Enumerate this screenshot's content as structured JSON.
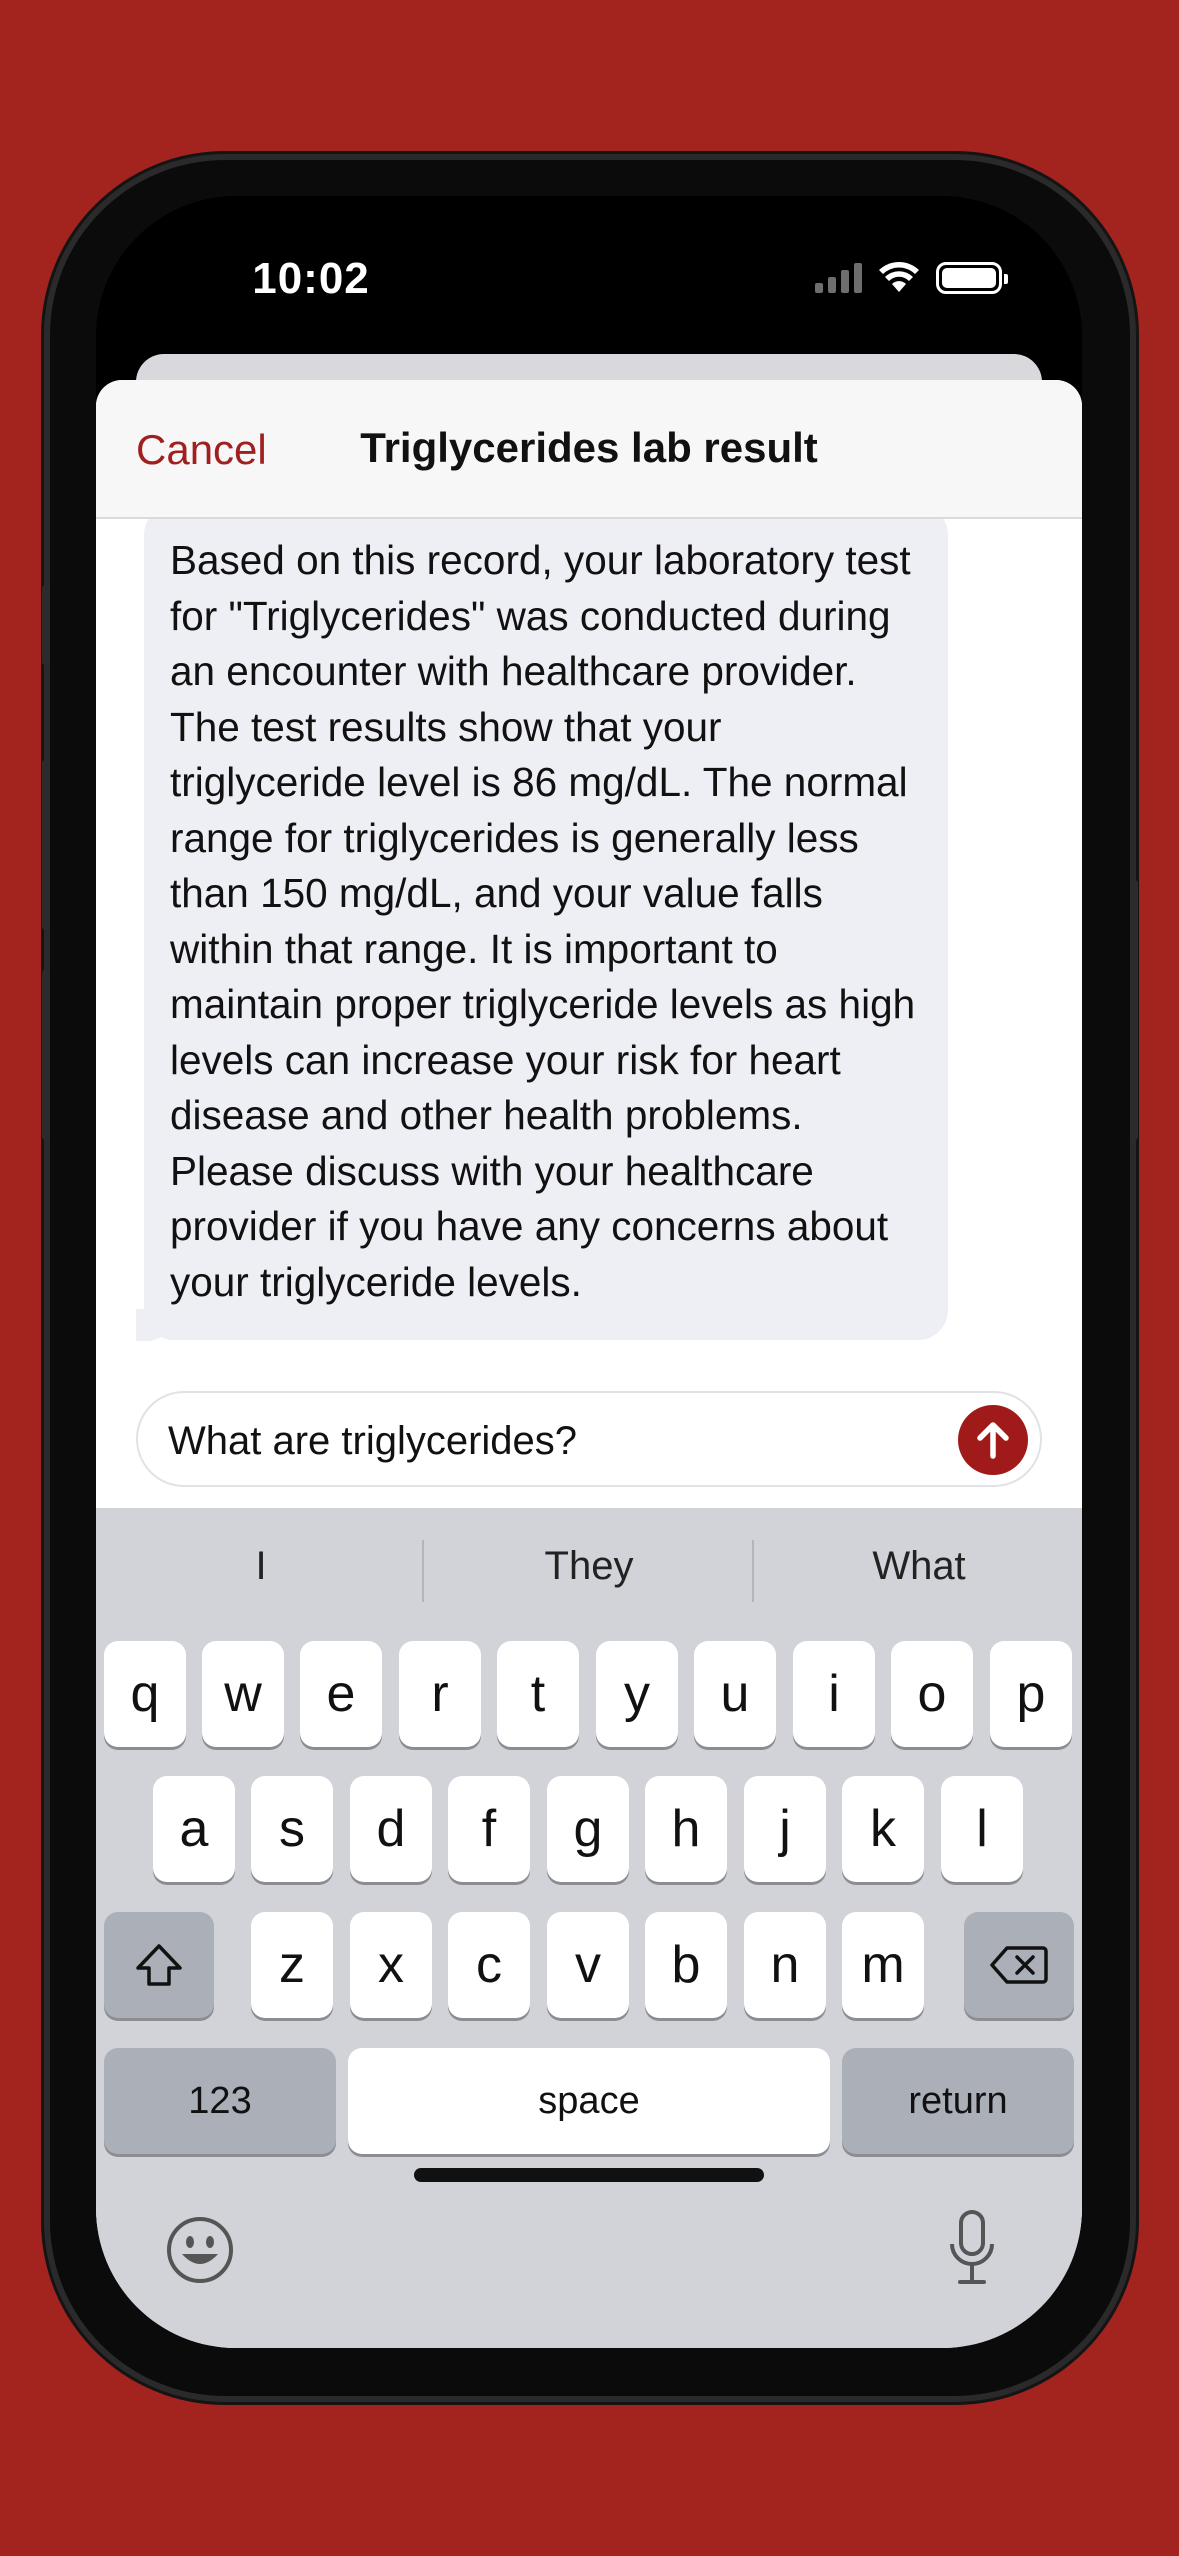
{
  "status_bar": {
    "time": "10:02"
  },
  "nav": {
    "cancel_label": "Cancel",
    "title": "Triglycerides lab result"
  },
  "chat": {
    "assistant_message": "Based on this record, your laboratory test for \"Triglycerides\" was conducted during an encounter with healthcare provider. The test results show that your triglyceride level is 86 mg/dL. The normal range for triglycerides is generally less than 150 mg/dL, and your value falls within that range. It is important to maintain proper triglyceride levels as high levels can increase your risk for heart disease and other health problems. Please discuss with your healthcare provider if you have any concerns about your triglyceride levels."
  },
  "composer": {
    "value": "What are triglycerides?",
    "send_icon": "arrow-up-icon"
  },
  "keyboard": {
    "predictions": [
      "I",
      "They",
      "What"
    ],
    "row1": [
      "q",
      "w",
      "e",
      "r",
      "t",
      "y",
      "u",
      "i",
      "o",
      "p"
    ],
    "row2": [
      "a",
      "s",
      "d",
      "f",
      "g",
      "h",
      "j",
      "k",
      "l"
    ],
    "row3": [
      "z",
      "x",
      "c",
      "v",
      "b",
      "n",
      "m"
    ],
    "numbers_label": "123",
    "space_label": "space",
    "return_label": "return"
  },
  "colors": {
    "accent": "#a11a1a",
    "background": "#a3241f",
    "keyboard": "#d1d3d9"
  }
}
